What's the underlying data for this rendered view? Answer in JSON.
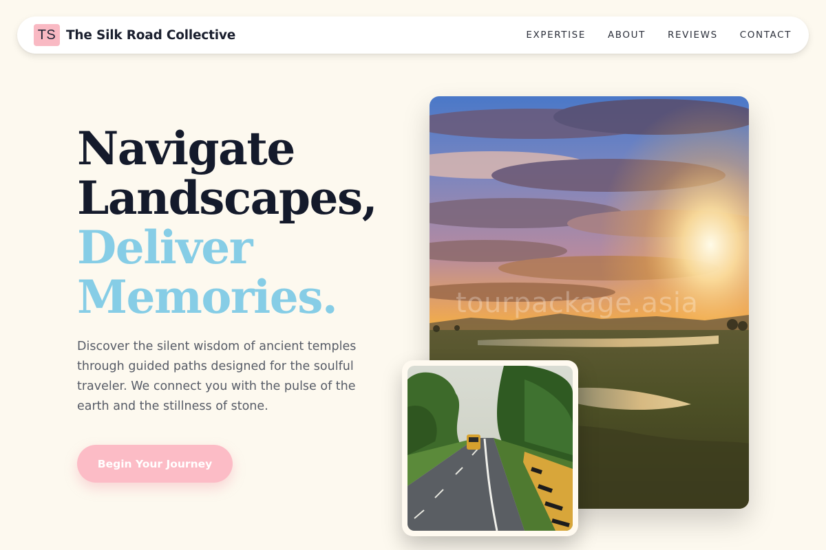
{
  "brand": {
    "initials": "TS",
    "name": "The Silk Road Collective"
  },
  "nav": {
    "items": [
      {
        "label": "EXPERTISE"
      },
      {
        "label": "ABOUT"
      },
      {
        "label": "REVIEWS"
      },
      {
        "label": "CONTACT"
      }
    ]
  },
  "hero": {
    "headline_line1": "Navigate",
    "headline_line2": "Landscapes,",
    "headline_line3": "Deliver",
    "headline_line4": "Memories.",
    "description": "Discover the silent wisdom of ancient temples through guided paths designed for the soulful traveler. We connect you with the pulse of the earth and the stillness of stone.",
    "cta_label": "Begin Your Journey"
  },
  "images": {
    "main_watermark": "tourpackage.asia"
  },
  "colors": {
    "background": "#fdf9ef",
    "headline_dark": "#141a2b",
    "headline_accent": "#86cde6",
    "cta_background": "#fcbcc6",
    "brand_mark": "#f9b9c3"
  }
}
